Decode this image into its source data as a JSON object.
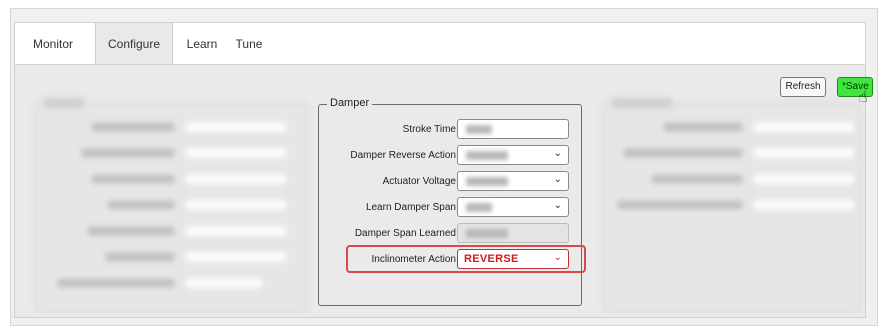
{
  "tabs": [
    "Monitor",
    "Configure",
    "Learn",
    "Tune"
  ],
  "active_tab": "Configure",
  "buttons": {
    "refresh": "Refresh",
    "save": "*Save"
  },
  "damper": {
    "legend": "Damper",
    "fields": [
      {
        "label": "Stroke Time",
        "type": "text"
      },
      {
        "label": "Damper Reverse Action",
        "type": "select"
      },
      {
        "label": "Actuator Voltage",
        "type": "select"
      },
      {
        "label": "Learn Damper Span",
        "type": "select"
      },
      {
        "label": "Damper Span Learned",
        "type": "readonly"
      },
      {
        "label": "Inclinometer Action",
        "type": "select",
        "value": "REVERSE"
      }
    ]
  },
  "colors": {
    "save_button": "#3ee63e",
    "highlight_border": "#d84a4a",
    "inclinometer_value": "#d01818"
  },
  "icons": {
    "dropdown": "chevron-down-icon",
    "cursor": "hand-pointer-icon"
  }
}
